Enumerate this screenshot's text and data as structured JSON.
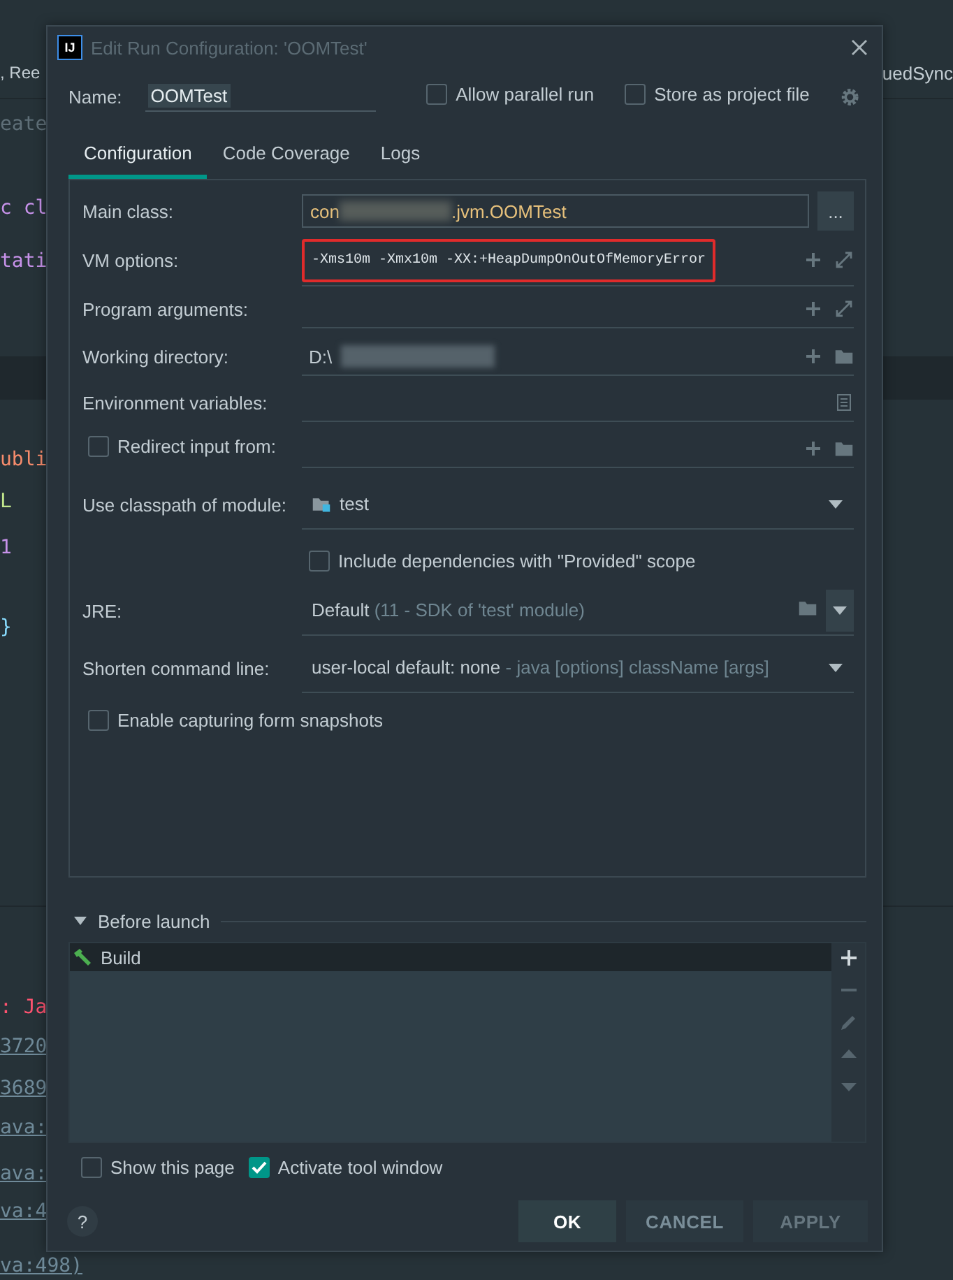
{
  "editor_background": {
    "left_lines": [
      {
        "text": ", Ree",
        "color": "#c3cdd3"
      },
      {
        "text": "eate",
        "color": "#5f6f78"
      },
      {
        "text": "c cl",
        "color": "#c792ea"
      },
      {
        "text": "tati",
        "color": "#c792ea"
      },
      {
        "text": "ubli",
        "color": "#f78c6c"
      },
      {
        "text": "L",
        "color": "#c3e88d"
      },
      {
        "text": "1",
        "color": "#c792ea"
      },
      {
        "text": "}",
        "color": "#89ddff"
      },
      {
        "text": ": Ja",
        "color": "#ff5370"
      },
      {
        "text": "3720",
        "color": "#6f8a99"
      },
      {
        "text": "3689",
        "color": "#6f8a99"
      },
      {
        "text": "ava:",
        "color": "#6f8a99"
      },
      {
        "text": "ava:",
        "color": "#6f8a99"
      },
      {
        "text": "va:4",
        "color": "#6f8a99"
      },
      {
        "text": "va:498)",
        "color": "#6f8a99"
      }
    ],
    "right_text": "uedSync"
  },
  "dialog": {
    "logo_text": "IJ",
    "title": "Edit Run Configuration: 'OOMTest'",
    "name_label": "Name:",
    "name_value": "OOMTest",
    "options": [
      {
        "label": "Allow parallel run",
        "checked": false
      },
      {
        "label": "Store as project file",
        "checked": false
      }
    ],
    "tabs": [
      {
        "label": "Configuration",
        "selected": true
      },
      {
        "label": "Code Coverage",
        "selected": false
      },
      {
        "label": "Logs",
        "selected": false
      }
    ],
    "fields": [
      {
        "kind": "box",
        "label": "Main class:",
        "value": "con",
        "value_after": ".jvm.OOMTest",
        "masked": true,
        "button": "..."
      },
      {
        "kind": "expandable",
        "label": "VM options:",
        "value": "-Xms10m -Xmx10m -XX:+HeapDumpOnOutOfMemoryError",
        "highlighted": true
      },
      {
        "kind": "expandable",
        "label": "Program arguments:"
      },
      {
        "kind": "path",
        "label": "Working directory:",
        "value": "D:\\",
        "masked": true
      },
      {
        "kind": "list",
        "label": "Environment variables:"
      },
      {
        "kind": "checkbox-path",
        "label": "Redirect input from:",
        "checked": false
      },
      {
        "kind": "module",
        "label": "Use classpath of module:",
        "value": "test"
      },
      {
        "kind": "checkbox",
        "label": "Include dependencies with \"Provided\" scope",
        "checked": false
      },
      {
        "kind": "jre",
        "label": "JRE:",
        "value": "Default",
        "hint": "(11 - SDK of 'test' module)"
      },
      {
        "kind": "dropdown",
        "label": "Shorten command line:",
        "value": "user-local default: none",
        "hint": "- java [options] className [args]"
      },
      {
        "kind": "checkbox-wide",
        "label": "Enable capturing form snapshots",
        "checked": false
      }
    ],
    "before_launch": {
      "title": "Before launch",
      "expanded": true,
      "tasks": [
        {
          "label": "Build",
          "selected": true
        }
      ],
      "tools": [
        {
          "kind": "add",
          "enabled": true
        },
        {
          "kind": "remove",
          "enabled": false
        },
        {
          "kind": "edit",
          "enabled": false
        },
        {
          "kind": "up",
          "enabled": false
        },
        {
          "kind": "down",
          "enabled": false
        }
      ]
    },
    "bottom_options": [
      {
        "label": "Show this page",
        "checked": false
      },
      {
        "label": "Activate tool window",
        "checked": true
      }
    ],
    "help": "?",
    "buttons": [
      {
        "label": "OK",
        "kind": "default",
        "disabled": false
      },
      {
        "label": "CANCEL",
        "kind": "normal",
        "disabled": false
      },
      {
        "label": "APPLY",
        "kind": "normal",
        "disabled": true
      }
    ]
  }
}
